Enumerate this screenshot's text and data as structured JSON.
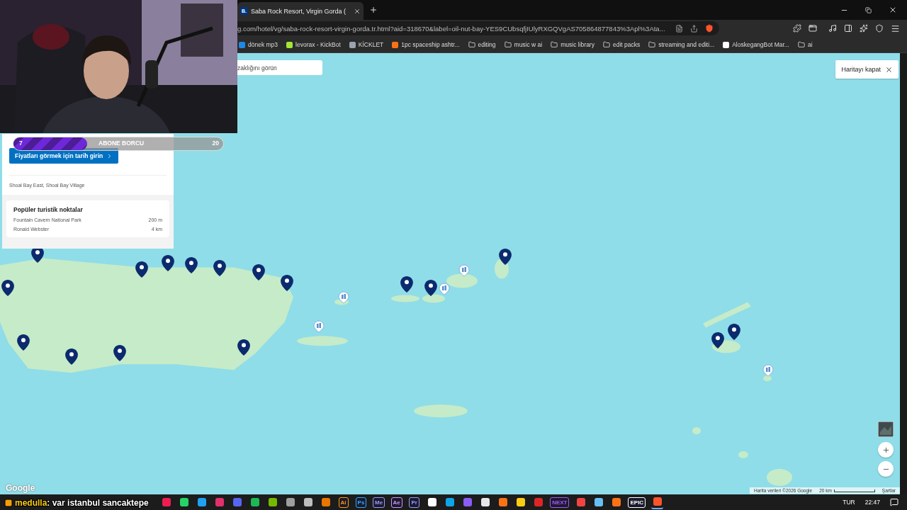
{
  "browser": {
    "tab": {
      "favicon": "B.",
      "title": "Saba Rock Resort, Virgin Gorda (",
      "selected": true
    },
    "address_bar": {
      "url": "g.com/hotel/vg/saba-rock-resort-virgin-gorda.tr.html?aid=318670&label=oil-nut-bay-YES9CUbsqfjIUlyRXGQVgAS705864877843%3Apl%3Ata..."
    },
    "bookmarks": [
      {
        "kind": "site",
        "label": "dönek mp3",
        "color": "#1e88e5"
      },
      {
        "kind": "site",
        "label": "levorax - KickBot",
        "color": "#a3e635"
      },
      {
        "kind": "site",
        "label": "KİCKLET",
        "color": "#9ca3af"
      },
      {
        "kind": "site",
        "label": "1pc spaceship ashtr...",
        "color": "#f97316"
      },
      {
        "kind": "folder",
        "label": "editing"
      },
      {
        "kind": "folder",
        "label": "music w ai"
      },
      {
        "kind": "folder",
        "label": "music library"
      },
      {
        "kind": "folder",
        "label": "edit packs"
      },
      {
        "kind": "folder",
        "label": "streaming and editi..."
      },
      {
        "kind": "site",
        "label": "AloskegangBot Mar...",
        "color": "#ffffff"
      },
      {
        "kind": "folder",
        "label": "ai"
      }
    ]
  },
  "map": {
    "search": {
      "placeholder": "zaklığını görün"
    },
    "close_button": "Haritayı kapat",
    "markers": [
      {
        "kind": "hotel"
      },
      {
        "kind": "hotel"
      },
      {
        "kind": "hotel"
      },
      {
        "kind": "hotel"
      },
      {
        "kind": "hotel"
      },
      {
        "kind": "hotel"
      },
      {
        "kind": "hotel"
      },
      {
        "kind": "hotel"
      },
      {
        "kind": "hotel"
      },
      {
        "kind": "hotel"
      },
      {
        "kind": "hotel"
      },
      {
        "kind": "hotel"
      },
      {
        "kind": "hotel"
      },
      {
        "kind": "hotel"
      },
      {
        "kind": "hotel"
      },
      {
        "kind": "hotel"
      },
      {
        "kind": "hotel"
      },
      {
        "kind": "landmark"
      },
      {
        "kind": "landmark"
      },
      {
        "kind": "landmark"
      },
      {
        "kind": "landmark"
      },
      {
        "kind": "landmark"
      }
    ],
    "logo": "Google",
    "attribution": "Harita verileri ©2026 Google",
    "scale": "20 km",
    "terms": "Şartlar"
  },
  "hotel_panel": {
    "date_button": "Fiyatları görmek için tarih girin",
    "location": "Shoal Bay East, Shoal Bay Village",
    "attractions": {
      "title": "Popüler turistik noktalar",
      "items": [
        {
          "name": "Fountain Cavern National Park",
          "distance": "200 m"
        },
        {
          "name": "Ronald Webster",
          "distance": "4 km"
        }
      ]
    }
  },
  "stream_overlay": {
    "goal": {
      "current": "7",
      "label": "ABONE BORCU",
      "target": "20",
      "level": 0.35
    },
    "chat": {
      "user": "medulla",
      "message": ": var istanbul sancaktepe"
    }
  },
  "taskbar": {
    "apps": [
      {
        "color": "#ee1d52",
        "selected": false
      },
      {
        "color": "#25d366",
        "selected": false
      },
      {
        "color": "#1da1f2",
        "selected": false
      },
      {
        "color": "#e1306c",
        "selected": false
      },
      {
        "color": "#5865f2",
        "selected": false
      },
      {
        "color": "#1db954",
        "selected": false
      },
      {
        "color": "#76b900",
        "selected": false
      },
      {
        "color": "#9e9e9e",
        "selected": false
      },
      {
        "color": "#bdbdbd",
        "selected": false
      },
      {
        "color": "#ea7600",
        "selected": false
      },
      {
        "color": "#ff9a00",
        "label": "Ai",
        "selected": false
      },
      {
        "color": "#31a8ff",
        "label": "Ps",
        "selected": false
      },
      {
        "color": "#9999ff",
        "label": "Me",
        "selected": false
      },
      {
        "color": "#d291ff",
        "label": "Ae",
        "selected": false
      },
      {
        "color": "#9999ff",
        "label": "Pr",
        "selected": false
      },
      {
        "color": "#ffffff",
        "selected": false
      },
      {
        "color": "#0ea5e9",
        "selected": false
      },
      {
        "color": "#8b5cf6",
        "selected": false
      },
      {
        "color": "#e5e7eb",
        "selected": false
      },
      {
        "color": "#f97316",
        "selected": false
      },
      {
        "color": "#facc15",
        "selected": false
      },
      {
        "color": "#dc2626",
        "selected": false
      },
      {
        "color": "#a855f7",
        "label": "NEXT",
        "selected": false
      },
      {
        "color": "#ef4444",
        "selected": false
      },
      {
        "color": "#66c0f4",
        "selected": false
      },
      {
        "color": "#f97316",
        "selected": false
      },
      {
        "color": "#ffffff",
        "label": "EPIC",
        "selected": false
      },
      {
        "color": "#fb542b",
        "selected": true
      }
    ],
    "language": "TUR",
    "time": "22:47"
  }
}
